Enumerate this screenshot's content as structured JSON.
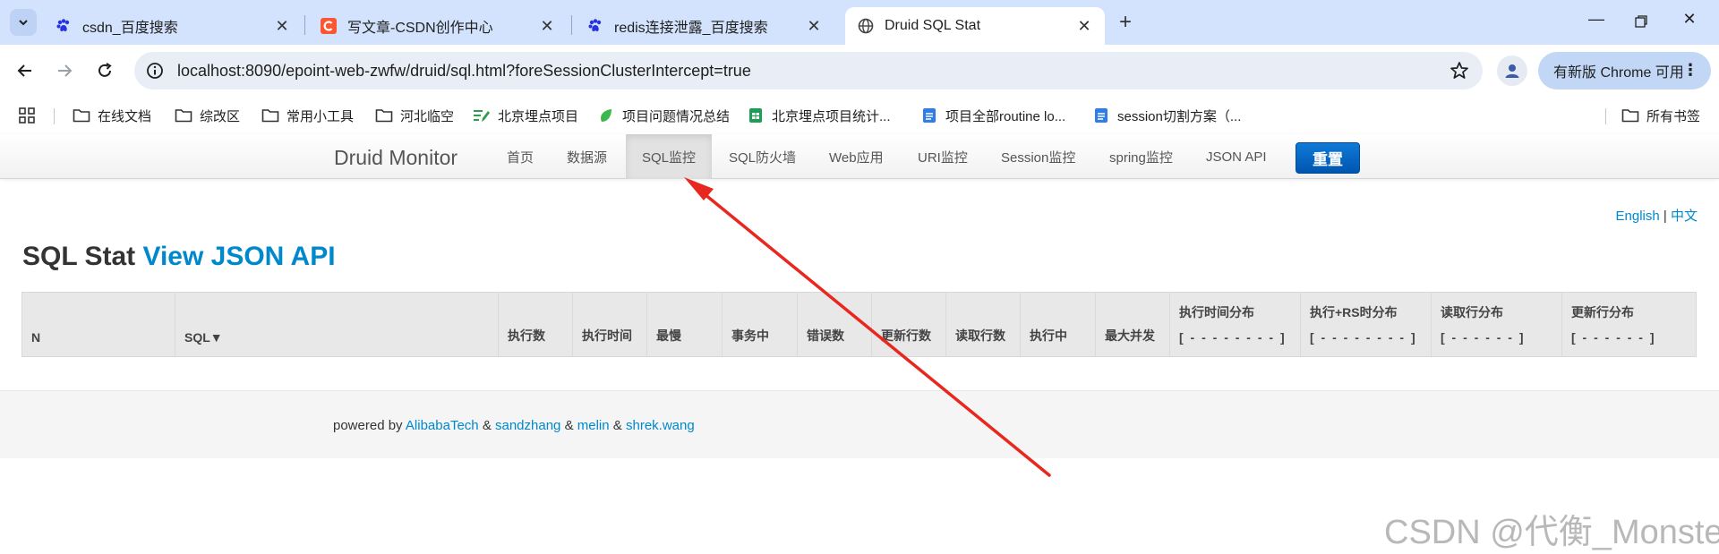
{
  "browser": {
    "tabs": [
      {
        "title": "csdn_百度搜索",
        "favicon": "baidu-paw-icon",
        "active": false
      },
      {
        "title": "写文章-CSDN创作中心",
        "favicon": "csdn-c-icon",
        "active": false
      },
      {
        "title": "redis连接泄露_百度搜索",
        "favicon": "baidu-paw-icon",
        "active": false
      },
      {
        "title": "Druid SQL Stat",
        "favicon": "globe-icon",
        "active": true
      }
    ],
    "new_tab_label": "+",
    "url_host": "localhost",
    "url_rest": ":8090/epoint-web-zwfw/druid/sql.html?foreSessionClusterIntercept=true",
    "update_button": "有新版 Chrome 可用",
    "bookmarks": [
      {
        "label": "在线文档",
        "icon": "folder-icon"
      },
      {
        "label": "综改区",
        "icon": "folder-icon"
      },
      {
        "label": "常用小工具",
        "icon": "folder-icon"
      },
      {
        "label": "河北临空",
        "icon": "folder-icon"
      },
      {
        "label": "北京埋点项目",
        "icon": "pen-list-icon"
      },
      {
        "label": "项目问题情况总结",
        "icon": "leaf-icon"
      },
      {
        "label": "北京埋点项目统计...",
        "icon": "sheet-icon"
      },
      {
        "label": "项目全部routine lo...",
        "icon": "doc-icon"
      },
      {
        "label": "session切割方案（...",
        "icon": "doc-icon"
      }
    ],
    "all_bookmarks": "所有书签"
  },
  "druid": {
    "brand": "Druid Monitor",
    "nav": [
      "首页",
      "数据源",
      "SQL监控",
      "SQL防火墙",
      "Web应用",
      "URI监控",
      "Session监控",
      "spring监控",
      "JSON API"
    ],
    "active_nav": "SQL监控",
    "reset_button": "重置",
    "lang_en": "English",
    "lang_sep": "|",
    "lang_zh": "中文",
    "heading_plain": "SQL Stat",
    "heading_link": "View JSON API",
    "table_columns": [
      {
        "top": "",
        "label": "N"
      },
      {
        "top": "",
        "label": "SQL▼"
      },
      {
        "top": "",
        "label": "执行数"
      },
      {
        "top": "",
        "label": "执行时间"
      },
      {
        "top": "",
        "label": "最慢"
      },
      {
        "top": "",
        "label": "事务中"
      },
      {
        "top": "",
        "label": "错误数"
      },
      {
        "top": "",
        "label": "更新行数"
      },
      {
        "top": "",
        "label": "读取行数"
      },
      {
        "top": "",
        "label": "执行中"
      },
      {
        "top": "",
        "label": "最大并发"
      },
      {
        "top": "执行时间分布",
        "label": "[ - - - - - - - - ]"
      },
      {
        "top": "执行+RS时分布",
        "label": "[ - - - - - - - - ]"
      },
      {
        "top": "读取行分布",
        "label": "[ - - - - - - ]"
      },
      {
        "top": "更新行分布",
        "label": "[ - - - - - - ]"
      }
    ],
    "footer": {
      "prefix": "powered by",
      "links": [
        "AlibabaTech",
        "sandzhang",
        "melin",
        "shrek.wang"
      ],
      "amp": "&"
    }
  },
  "annotation": {
    "arrow_color": "#e8271f"
  },
  "watermark": "CSDN @代衡_Monster"
}
